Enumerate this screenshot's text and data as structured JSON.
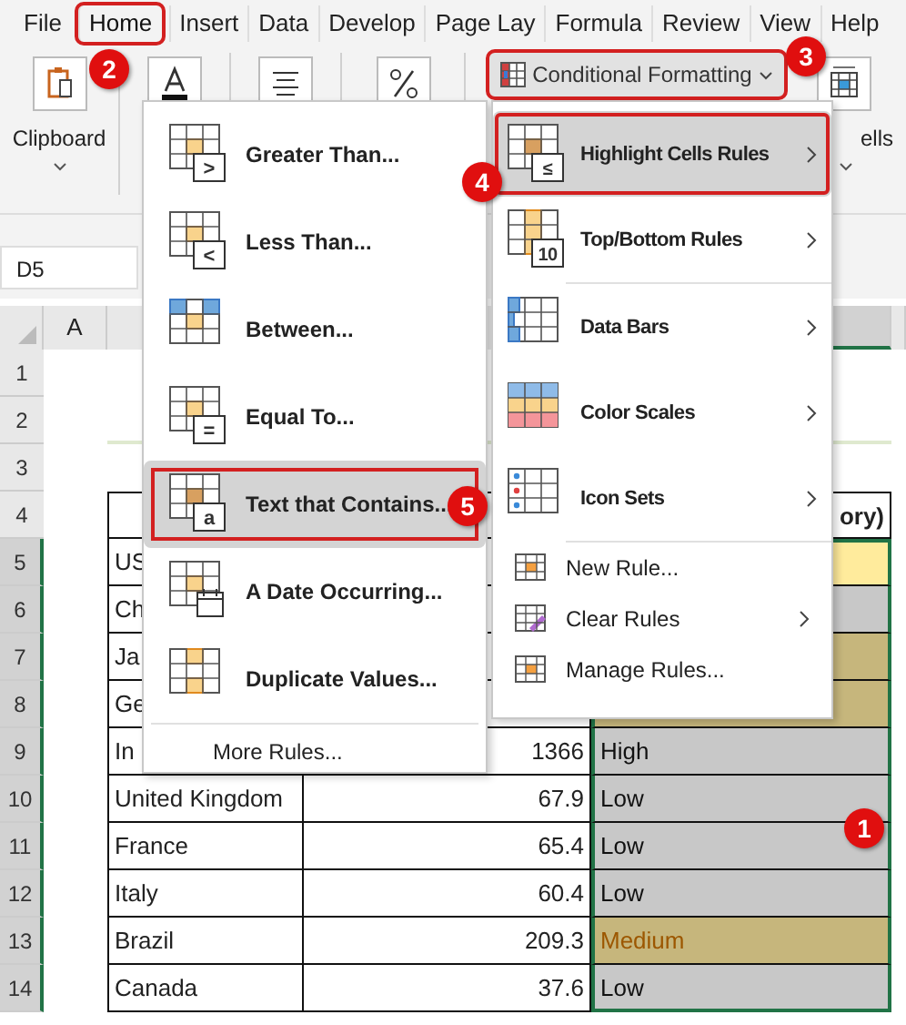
{
  "ribbon_tabs": [
    {
      "label": "File",
      "selected": false
    },
    {
      "label": "Home",
      "selected": true
    },
    {
      "label": "Insert",
      "selected": false
    },
    {
      "label": "Data",
      "selected": false
    },
    {
      "label": "Develop",
      "selected": false
    },
    {
      "label": "Page Lay",
      "selected": false
    },
    {
      "label": "Formula",
      "selected": false
    },
    {
      "label": "Review",
      "selected": false
    },
    {
      "label": "View",
      "selected": false
    },
    {
      "label": "Help",
      "selected": false
    }
  ],
  "ribbon_groups": [
    {
      "kind": "clipboard",
      "label": "Clipboard"
    },
    {
      "kind": "font"
    },
    {
      "kind": "align"
    },
    {
      "kind": "number"
    },
    {
      "kind": "conditional",
      "label": "Conditional Formatting",
      "selected": true
    },
    {
      "kind": "cells",
      "label": "ells"
    }
  ],
  "name_box": "D5",
  "columns": [
    "A"
  ],
  "row_numbers": [
    "1",
    "2",
    "3",
    "4",
    "5",
    "6",
    "7",
    "8",
    "9",
    "10",
    "11",
    "12",
    "13",
    "14"
  ],
  "table": {
    "header_fragment": "ory)",
    "rows": [
      {
        "country": "US",
        "color": "#ffeb9c",
        "selected": true
      },
      {
        "country": "Ch",
        "color": "#c8c8c8",
        "selected": true
      },
      {
        "country": "Ja",
        "color": "#c6b67c",
        "selected": true
      },
      {
        "country": "Ge",
        "color": "#c6b67c",
        "selected": true
      },
      {
        "country": "In",
        "value": "1366",
        "category": "High",
        "color": "#c8c8c8",
        "selected": true
      },
      {
        "country": "United Kingdom",
        "value": "67.9",
        "category": "Low",
        "color": "#c8c8c8",
        "selected": true
      },
      {
        "country": "France",
        "value": "65.4",
        "category": "Low",
        "color": "#c8c8c8",
        "selected": true
      },
      {
        "country": "Italy",
        "value": "60.4",
        "category": "Low",
        "color": "#c8c8c8",
        "selected": true
      },
      {
        "country": "Brazil",
        "value": "209.3",
        "category": "Medium",
        "color": "#c6b67c",
        "dark_text": true,
        "selected": true
      },
      {
        "country": "Canada",
        "value": "37.6",
        "category": "Low",
        "color": "#c8c8c8",
        "selected": true
      }
    ]
  },
  "menu": {
    "items": [
      {
        "label": "Greater Than...",
        "symbol": ">",
        "selected": false
      },
      {
        "label": "Less Than...",
        "symbol": "<",
        "selected": false
      },
      {
        "label": "Between...",
        "kind": "between",
        "selected": false
      },
      {
        "label": "Equal To...",
        "symbol": "=",
        "selected": false
      },
      {
        "label": "Text that Contains...",
        "symbol": "a",
        "selected": true
      },
      {
        "label": "A Date Occurring...",
        "kind": "date",
        "selected": false
      },
      {
        "label": "Duplicate Values...",
        "kind": "duplicate",
        "selected": false
      }
    ],
    "footer": "More Rules..."
  },
  "submenu": {
    "items": [
      {
        "label": "Highlight Cells Rules",
        "kind": "highlight",
        "symbol": "≤",
        "has_submenu": true,
        "selected": true
      },
      {
        "label": "Top/Bottom Rules",
        "kind": "topbottom",
        "symbol": "10",
        "has_submenu": true,
        "selected": false
      },
      {
        "label": "Data Bars",
        "kind": "databars",
        "has_submenu": true,
        "selected": false
      },
      {
        "label": "Color Scales",
        "kind": "colorscales",
        "has_submenu": true,
        "selected": false
      },
      {
        "label": "Icon Sets",
        "kind": "iconsets",
        "has_submenu": true,
        "selected": false
      }
    ],
    "small_items": [
      {
        "label": "New Rule...",
        "kind": "new",
        "has_submenu": false
      },
      {
        "label": "Clear Rules",
        "kind": "clear",
        "has_submenu": true
      },
      {
        "label": "Manage Rules...",
        "kind": "manage",
        "has_submenu": false
      }
    ]
  },
  "callouts": [
    "2",
    "3",
    "4",
    "5",
    "1"
  ]
}
